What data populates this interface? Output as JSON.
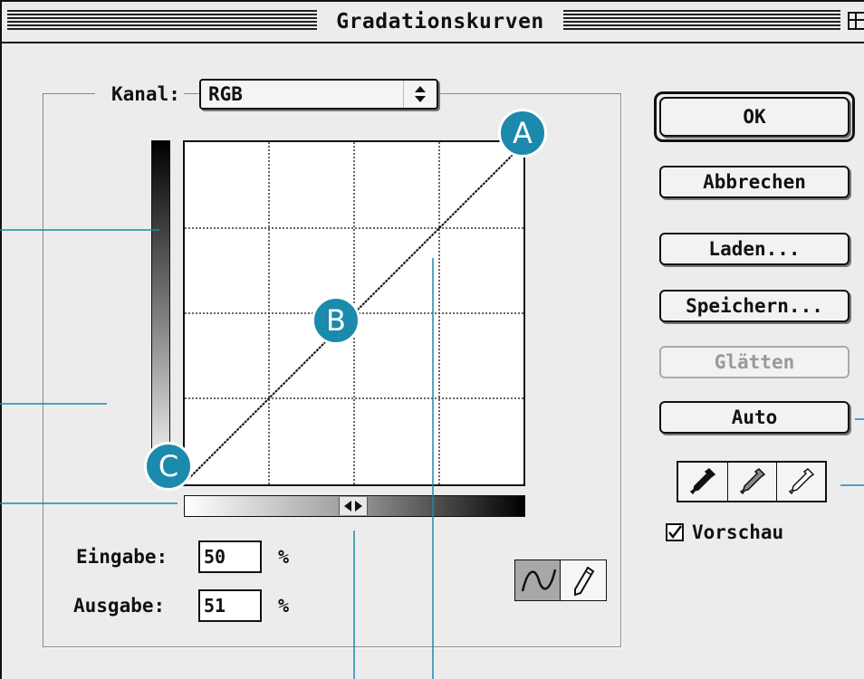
{
  "window": {
    "title": "Gradationskurven"
  },
  "channel": {
    "label": "Kanal:",
    "selected": "RGB"
  },
  "buttons": {
    "ok": "OK",
    "cancel": "Abbrechen",
    "load": "Laden...",
    "save": "Speichern...",
    "smooth": "Glätten",
    "auto": "Auto"
  },
  "inputs": {
    "input_label": "Eingabe:",
    "input_value": "50",
    "output_label": "Ausgabe:",
    "output_value": "51",
    "unit": "%"
  },
  "preview": {
    "label": "Vorschau",
    "checked": true
  },
  "callout_badges": [
    "A",
    "B",
    "C"
  ],
  "icons": [
    "curve-tool-icon",
    "pencil-tool-icon",
    "black-eyedropper-icon",
    "gray-eyedropper-icon",
    "white-eyedropper-icon",
    "updown-arrows-icon",
    "gradient-toggle-icon",
    "zoom-box-icon"
  ],
  "colors": {
    "callout": "#1b8aac",
    "window_bg": "#ececec"
  }
}
